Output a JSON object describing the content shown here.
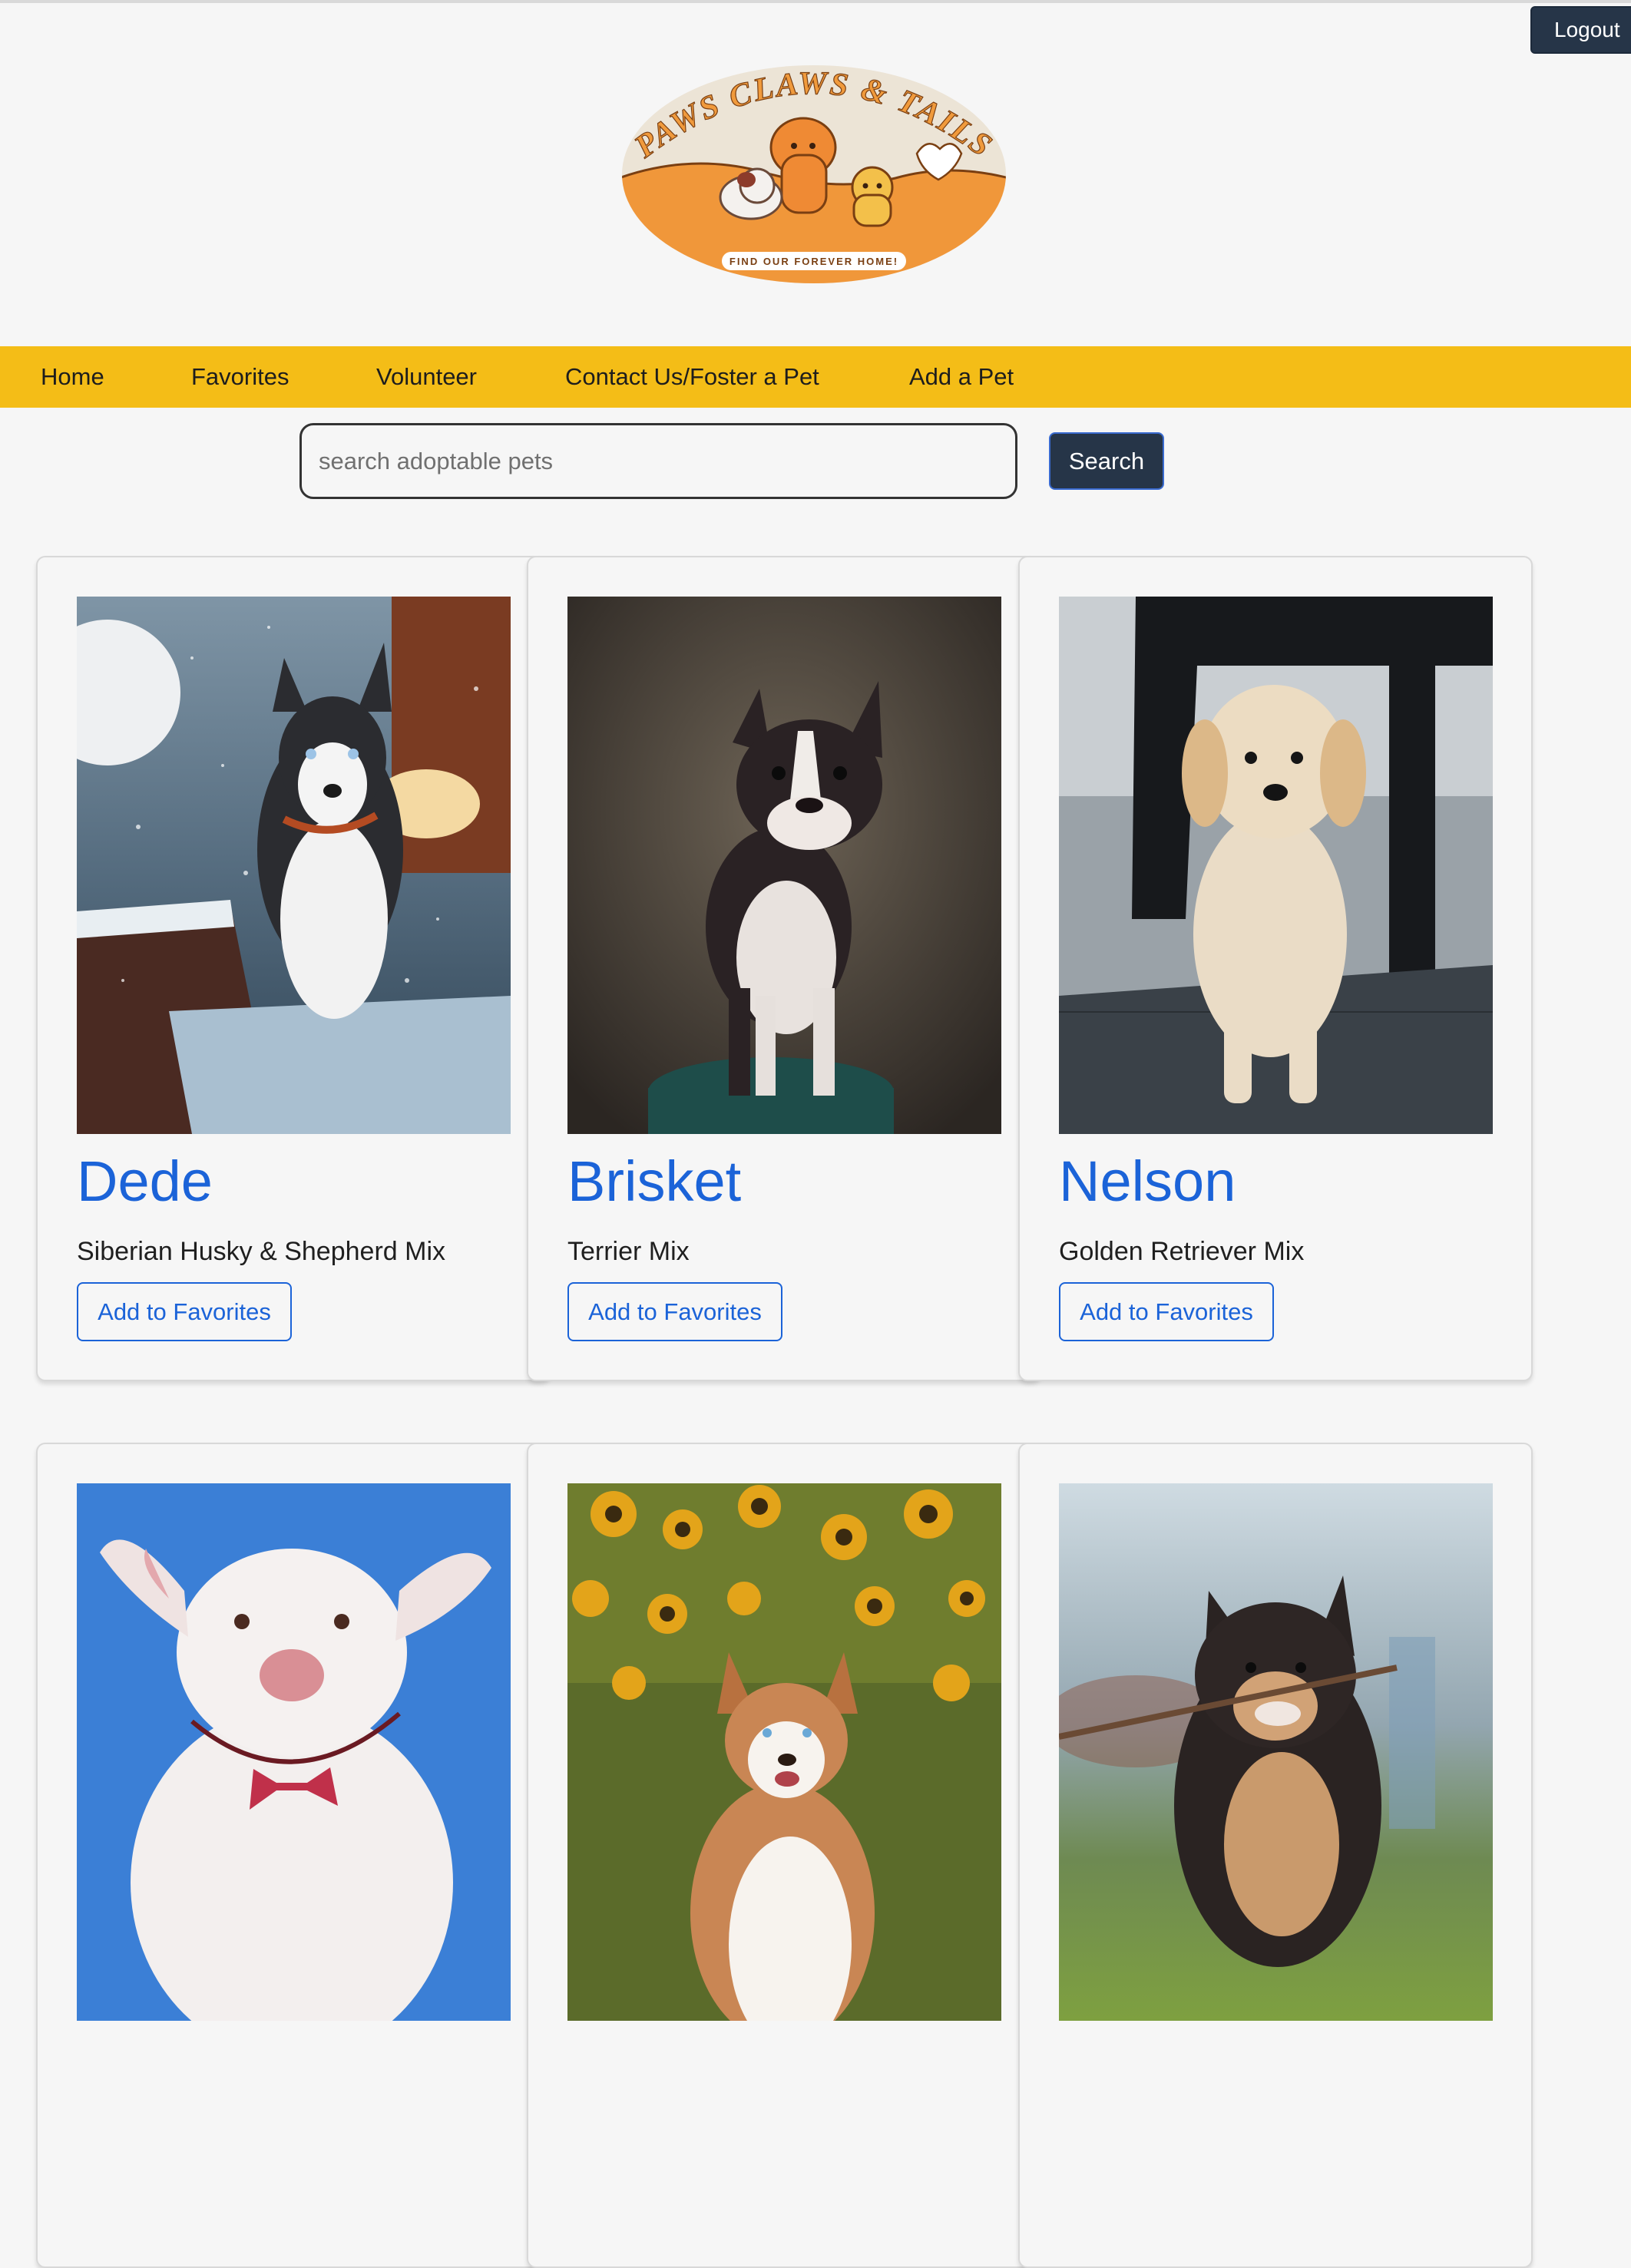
{
  "header": {
    "logout_label": "Logout",
    "logo": {
      "title": "PAWS CLAWS & TAILS",
      "tagline": "FIND OUR FOREVER HOME!"
    }
  },
  "nav": {
    "items": [
      {
        "label": "Home"
      },
      {
        "label": "Favorites"
      },
      {
        "label": "Volunteer"
      },
      {
        "label": "Contact Us/Foster a Pet"
      },
      {
        "label": "Add a Pet"
      }
    ]
  },
  "search": {
    "placeholder": "search adoptable pets",
    "button_label": "Search"
  },
  "pets": [
    {
      "name": "Dede",
      "breed": "Siberian Husky & Shepherd Mix",
      "button_label": "Add to Favorites"
    },
    {
      "name": "Brisket",
      "breed": "Terrier Mix",
      "button_label": "Add to Favorites"
    },
    {
      "name": "Nelson",
      "breed": "Golden Retriever Mix",
      "button_label": "Add to Favorites"
    }
  ],
  "colors": {
    "nav_background": "#f4bd17",
    "button_dark": "#263548",
    "link_blue": "#1b63d8",
    "page_background": "#f6f6f6"
  }
}
